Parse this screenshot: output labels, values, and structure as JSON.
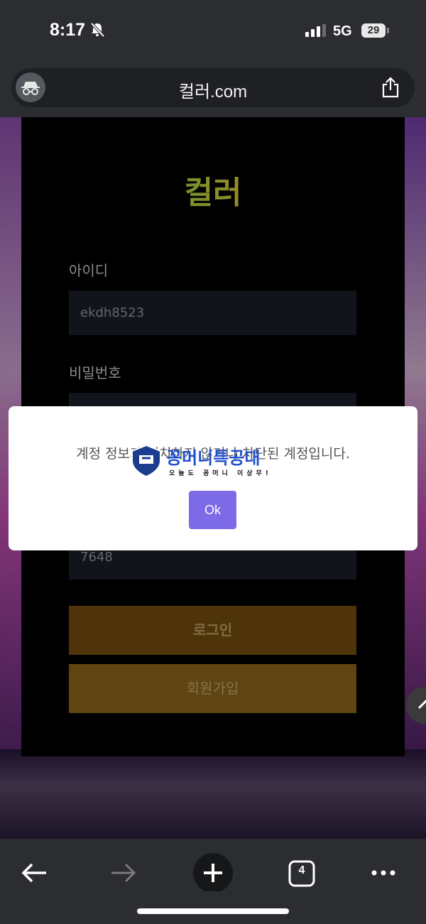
{
  "status_bar": {
    "time": "8:17",
    "network": "5G",
    "battery": "29"
  },
  "browser": {
    "url": "컬러.com",
    "tab_count": "4"
  },
  "page": {
    "logo": "컬러",
    "id_label": "아이디",
    "id_value": "ekdh8523",
    "pw_label": "비밀번호",
    "captcha_value": "7648",
    "login_button": "로그인",
    "signup_button": "회원가입"
  },
  "dialog": {
    "message": "계정 정보가 일치하지 않거나 차단된 계정입니다.",
    "ok_button": "Ok"
  },
  "watermark": {
    "title": "꽁머니특공대",
    "subtitle": "오늘도 꽁머니 이상무!"
  },
  "colors": {
    "dialog_ok": "#7c6ae6",
    "login_button": "#7a500e",
    "signup_button": "#946b1c"
  }
}
